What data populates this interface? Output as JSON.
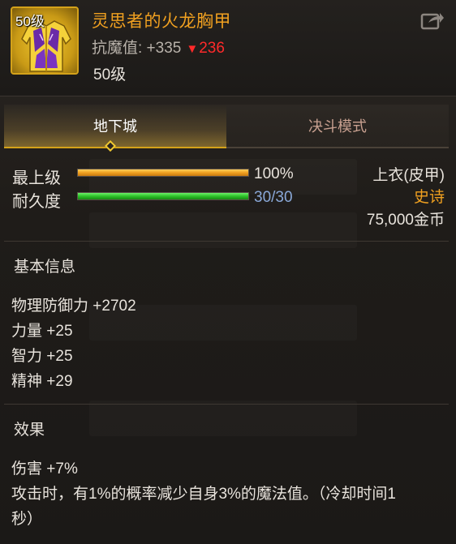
{
  "item": {
    "level_badge": "50级",
    "name": "灵思者的火龙胸甲",
    "resist_label": "抗魔值: +335",
    "resist_change": "236",
    "required_level": "50级"
  },
  "tabs": [
    {
      "label": "地下城",
      "active": true
    },
    {
      "label": "决斗模式",
      "active": false
    }
  ],
  "stats": {
    "max_level": {
      "label": "最上级",
      "value_text": "100%",
      "fill": 1.0
    },
    "durability": {
      "label": "耐久度",
      "value_text": "30/30",
      "fill": 1.0
    }
  },
  "meta": {
    "slot_type": "上衣(皮甲)",
    "rarity": "史诗",
    "price": "75,000金币"
  },
  "basic_info": {
    "title": "基本信息",
    "lines": [
      "物理防御力 +2702",
      "力量 +25",
      "智力 +25",
      "精神 +29"
    ]
  },
  "effects": {
    "title": "效果",
    "lines": [
      "伤害 +7%",
      "攻击时，有1%的概率减少自身3%的魔法值。（冷却时间1",
      "秒）"
    ]
  },
  "colors": {
    "accent_gold": "#d4a21a",
    "item_name": "#f0a020",
    "resist_down": "#ff2a2a",
    "durability_text": "#8aa8d8"
  },
  "icons": {
    "share": "share-icon",
    "tab_marker": "diamond-marker-icon",
    "armor": "chest-armor-icon"
  }
}
